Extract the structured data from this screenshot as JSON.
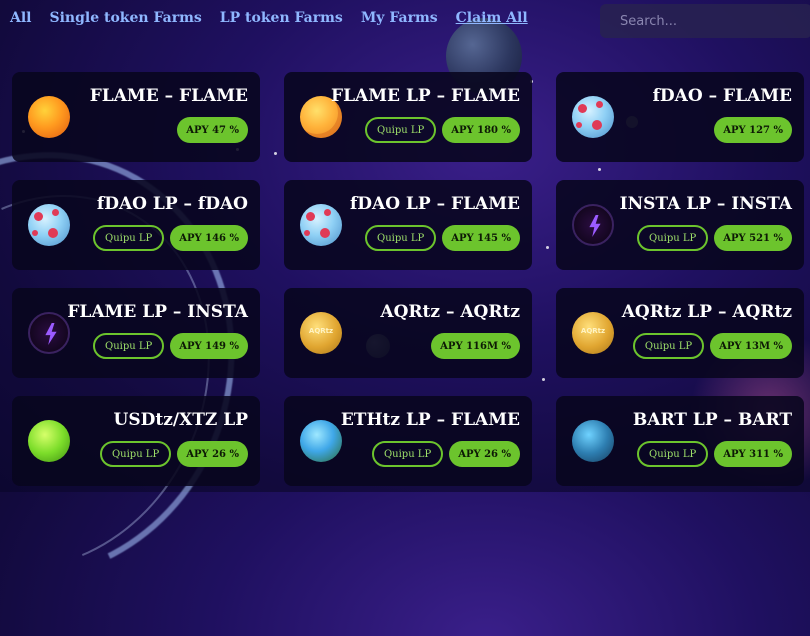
{
  "nav": {
    "items": [
      {
        "label": "All"
      },
      {
        "label": "Single token Farms"
      },
      {
        "label": "LP token Farms"
      },
      {
        "label": "My Farms"
      },
      {
        "label": "Claim All"
      }
    ]
  },
  "search": {
    "placeholder": "Search..."
  },
  "colors": {
    "accent_green": "#6cc42d",
    "nav_blue": "#8fb7ff",
    "card_bg": "#08061e"
  },
  "farms": [
    {
      "title": "FLAME – FLAME",
      "token_icon": "flame-token-icon",
      "quipu": null,
      "apy": "APY 47 %"
    },
    {
      "title": "FLAME LP – FLAME",
      "token_icon": "flame-lp-token-icon",
      "quipu": "Quipu LP",
      "apy": "APY 180 %"
    },
    {
      "title": "fDAO – FLAME",
      "token_icon": "fdao-token-icon",
      "quipu": null,
      "apy": "APY 127 %"
    },
    {
      "title": "fDAO LP – fDAO",
      "token_icon": "fdao-token-icon",
      "quipu": "Quipu LP",
      "apy": "APY 146 %"
    },
    {
      "title": "fDAO LP – FLAME",
      "token_icon": "fdao-token-icon",
      "quipu": "Quipu LP",
      "apy": "APY 145 %"
    },
    {
      "title": "INSTA LP – INSTA",
      "token_icon": "insta-token-icon",
      "quipu": "Quipu LP",
      "apy": "APY 521 %"
    },
    {
      "title": "FLAME LP – INSTA",
      "token_icon": "insta-token-icon",
      "quipu": "Quipu LP",
      "apy": "APY 149 %"
    },
    {
      "title": "AQRtz – AQRtz",
      "token_icon": "aqrtz-token-icon",
      "quipu": null,
      "apy": "APY 116M %"
    },
    {
      "title": "AQRtz LP – AQRtz",
      "token_icon": "aqrtz-token-icon",
      "quipu": "Quipu LP",
      "apy": "APY 13M %"
    },
    {
      "title": "USDtz/XTZ LP",
      "token_icon": "usdtz-token-icon",
      "quipu": "Quipu LP",
      "apy": "APY 26 %"
    },
    {
      "title": "ETHtz LP – FLAME",
      "token_icon": "ethtz-token-icon",
      "quipu": "Quipu LP",
      "apy": "APY 26 %"
    },
    {
      "title": "BART LP – BART",
      "token_icon": "bart-token-icon",
      "quipu": "Quipu LP",
      "apy": "APY 311 %"
    }
  ],
  "coin_label": "AQRtz"
}
